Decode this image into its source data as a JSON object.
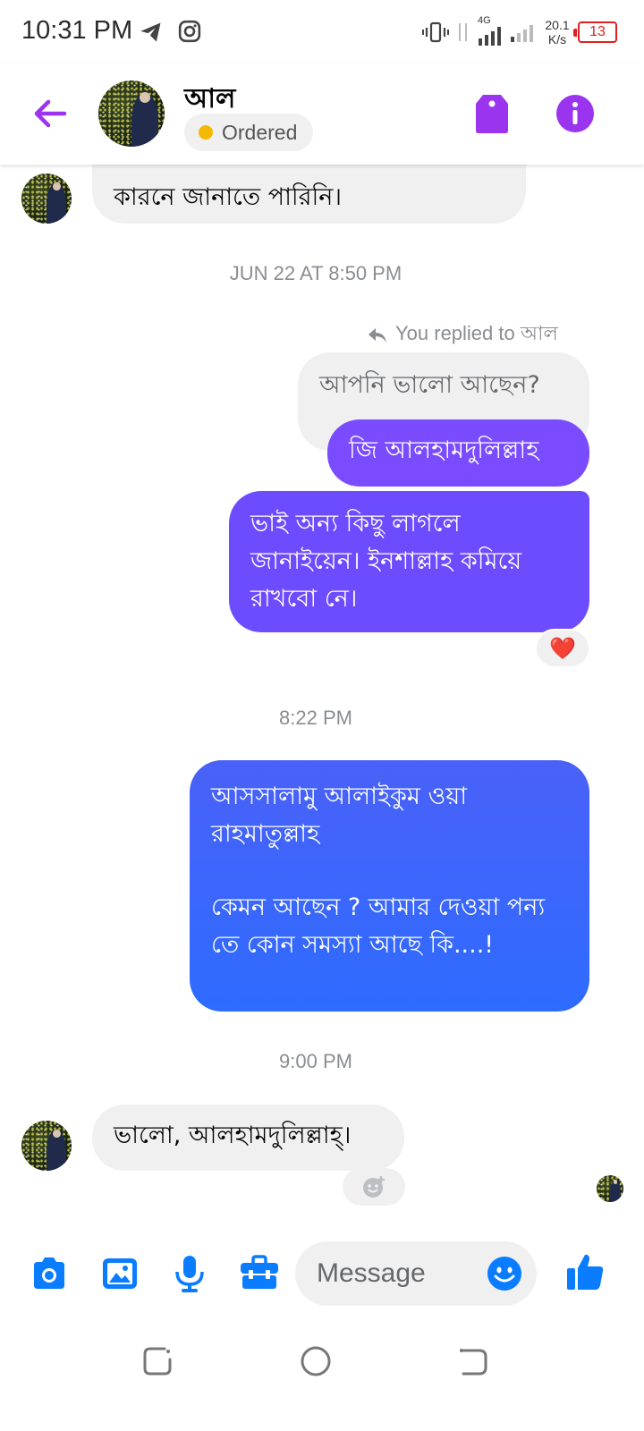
{
  "status_bar": {
    "time": "10:31 PM",
    "net_speed_value": "20.1",
    "net_speed_unit": "K/s",
    "network_type": "4G",
    "battery": "13"
  },
  "header": {
    "contact_name": "আল",
    "status_label": "Ordered",
    "status_color": "#f5b800",
    "accent_color": "#9b34ef"
  },
  "messages": {
    "m0_tail": "কারনে জানাতে পারিনি।",
    "sep1": "JUN 22 AT 8:50 PM",
    "replied_label": "You replied to আল",
    "m1_quoted": "আপনি ভালো আছেন?",
    "m2": "জি আলহামদুলিল্লাহ",
    "m3": "ভাই অন্য কিছু লাগলে জানাইয়েন। ইনশাল্লাহ কমিয়ে রাখবো নে।",
    "m3_reaction": "❤️",
    "sep2": "8:22 PM",
    "m4_line1": "আসসালামু আলাইকুম ওয়া রাহমাতুল্লাহ",
    "m4_line2": "কেমন আছেন ? আমার দেওয়া পন্য তে কোন সমস্যা আছে কি....!",
    "sep3": "9:00 PM",
    "m5": "ভালো, আলহামদুলিল্লাহ্।"
  },
  "composer": {
    "placeholder": "Message"
  },
  "icons": {
    "back": "back-arrow-icon",
    "tag": "tag-icon",
    "info": "info-icon",
    "camera": "camera-icon",
    "gallery": "gallery-icon",
    "mic": "mic-icon",
    "toolbox": "toolbox-icon",
    "emoji": "emoji-icon",
    "like": "thumbs-up-icon",
    "composer_color": "#0a7cff"
  }
}
